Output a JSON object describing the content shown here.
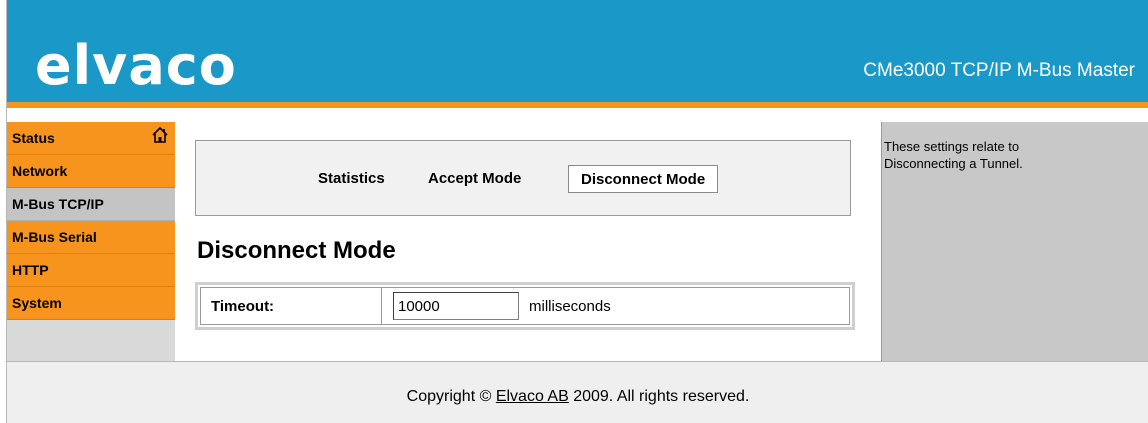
{
  "header": {
    "logo_text": "elvaco",
    "product_title": "CMe3000 TCP/IP M-Bus Master"
  },
  "sidebar": {
    "items": [
      {
        "label": "Status",
        "icon": "home-icon",
        "active": false
      },
      {
        "label": "Network",
        "active": false
      },
      {
        "label": "M-Bus TCP/IP",
        "active": true
      },
      {
        "label": "M-Bus Serial",
        "active": false
      },
      {
        "label": "HTTP",
        "active": false
      },
      {
        "label": "System",
        "active": false
      }
    ]
  },
  "tabs": [
    {
      "label": "Statistics",
      "selected": false
    },
    {
      "label": "Accept Mode",
      "selected": false
    },
    {
      "label": "Disconnect Mode",
      "selected": true
    }
  ],
  "section": {
    "title": "Disconnect Mode",
    "fields": [
      {
        "label": "Timeout:",
        "value": "10000",
        "unit": "milliseconds"
      }
    ]
  },
  "help": {
    "text": "These settings relate to Disconnecting a Tunnel."
  },
  "footer": {
    "prefix": "Copyright © ",
    "link": "Elvaco AB",
    "suffix": " 2009. All rights reserved."
  },
  "colors": {
    "header_blue": "#1a98c8",
    "accent_orange": "#f7941d",
    "active_grey": "#c4c4c4",
    "help_grey": "#c8c8c8"
  }
}
